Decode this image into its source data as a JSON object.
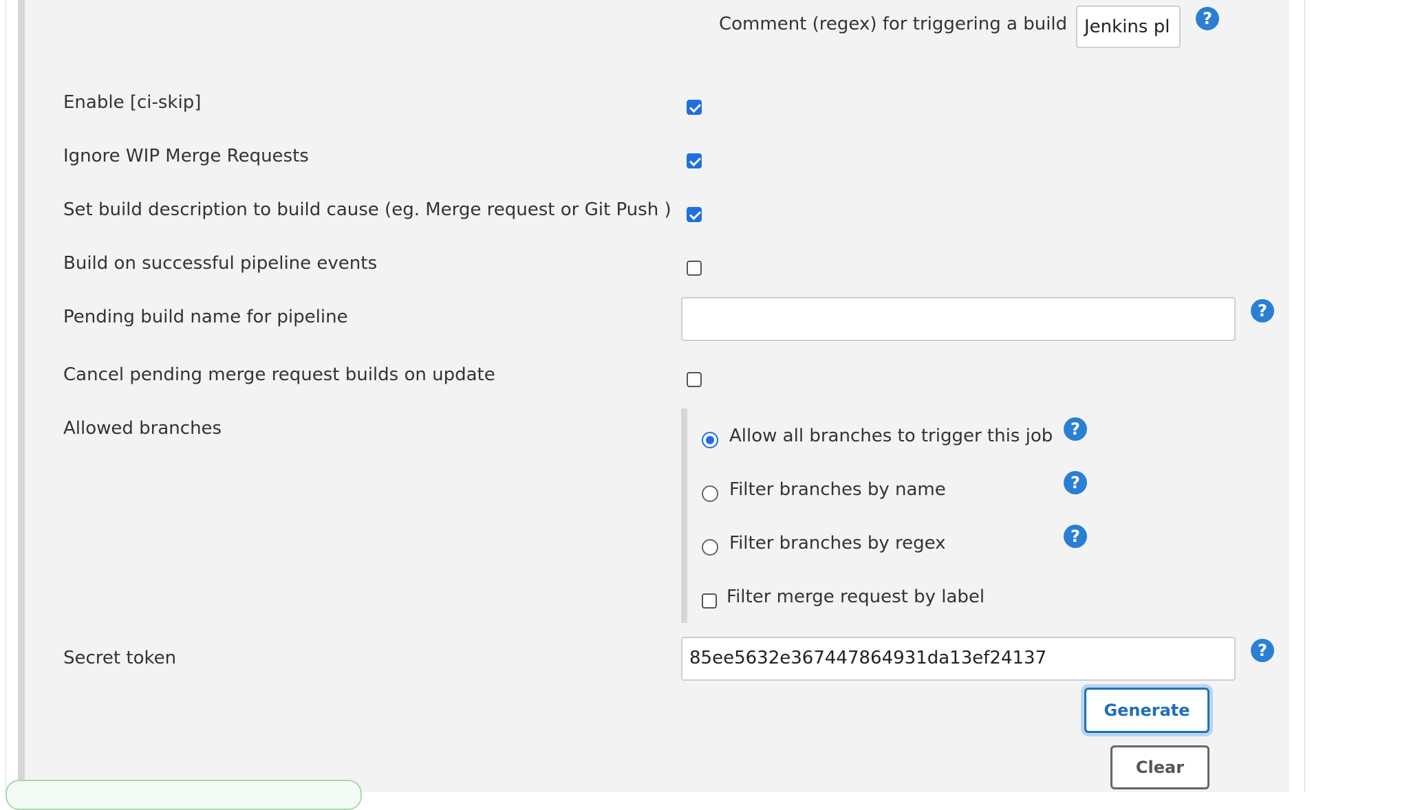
{
  "comment_trigger": {
    "label": "Comment (regex) for triggering a build",
    "value": "Jenkins pl"
  },
  "options": {
    "enable_ci_skip": {
      "label": "Enable [ci-skip]",
      "checked": true
    },
    "ignore_wip": {
      "label": "Ignore WIP Merge Requests",
      "checked": true
    },
    "set_build_description": {
      "label": "Set build description to build cause (eg. Merge request or Git Push )",
      "checked": true
    },
    "build_on_pipeline": {
      "label": "Build on successful pipeline events",
      "checked": false
    },
    "pending_build_name": {
      "label": "Pending build name for pipeline",
      "value": ""
    },
    "cancel_pending": {
      "label": "Cancel pending merge request builds on update",
      "checked": false
    }
  },
  "allowed_branches": {
    "label": "Allowed branches",
    "choices": [
      {
        "label": "Allow all branches to trigger this job",
        "selected": true
      },
      {
        "label": "Filter branches by name",
        "selected": false
      },
      {
        "label": "Filter branches by regex",
        "selected": false
      }
    ],
    "filter_by_label": {
      "label": "Filter merge request by label",
      "checked": false
    }
  },
  "secret_token": {
    "label": "Secret token",
    "value": "85ee5632e367447864931da13ef24137",
    "generate_label": "Generate",
    "clear_label": "Clear"
  },
  "help_glyph": "?",
  "colors": {
    "accent": "#1f6fe0",
    "help": "#2a7fd4",
    "panel_background": "#f3f3f3",
    "generate_button": "#1f6fb5"
  }
}
